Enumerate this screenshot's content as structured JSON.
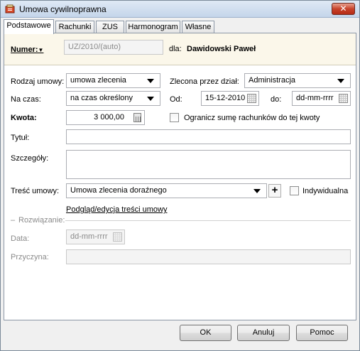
{
  "window": {
    "title": "Umowa cywilnoprawna",
    "close_glyph": "✕",
    "icon": "contract-app-icon"
  },
  "tabs": [
    {
      "label": "Podstawowe",
      "active": true
    },
    {
      "label": "Rachunki",
      "active": false
    },
    {
      "label": "ZUS",
      "active": false
    },
    {
      "label": "Harmonogram",
      "active": false
    },
    {
      "label": "Własne",
      "active": false
    }
  ],
  "header": {
    "number_label": "Numer:",
    "number_dropdown_glyph": "▼",
    "number_value": "UZ/2010/(auto)",
    "for_label": "dla:",
    "person_name": "Dawidowski Paweł"
  },
  "form": {
    "contract_type_label": "Rodzaj umowy:",
    "contract_type_value": "umowa zlecenia",
    "ordered_by_label": "Zlecona przez dział:",
    "ordered_by_value": "Administracja",
    "duration_label": "Na czas:",
    "duration_value": "na czas określony",
    "from_label": "Od:",
    "from_value": "15-12-2010",
    "to_label": "do:",
    "to_placeholder": "dd-mm-rrrr",
    "amount_label": "Kwota:",
    "amount_value": "3 000,00",
    "limit_checkbox_label": "Ogranicz sumę rachunków do tej kwoty",
    "limit_checked": false,
    "title_label": "Tytuł:",
    "title_value": "",
    "details_label": "Szczegóły:",
    "details_value": "",
    "content_label": "Treść umowy:",
    "content_value": "Umowa zlecenia doraźnego",
    "add_glyph": "+",
    "individual_label": "Indywidualna",
    "individual_checked": false,
    "preview_link": "Podgląd/edycja treści umowy"
  },
  "termination": {
    "section_label": "Rozwiązanie:",
    "date_label": "Data:",
    "date_placeholder": "dd-mm-rrrr",
    "reason_label": "Przyczyna:",
    "reason_value": ""
  },
  "footer": {
    "ok_label": "OK",
    "cancel_label": "Anuluj",
    "help_label": "Pomoc"
  },
  "colors": {
    "header_strip": "#fbf7ea",
    "close_button": "#c7432b",
    "titlebar": "#c4d5ea"
  }
}
